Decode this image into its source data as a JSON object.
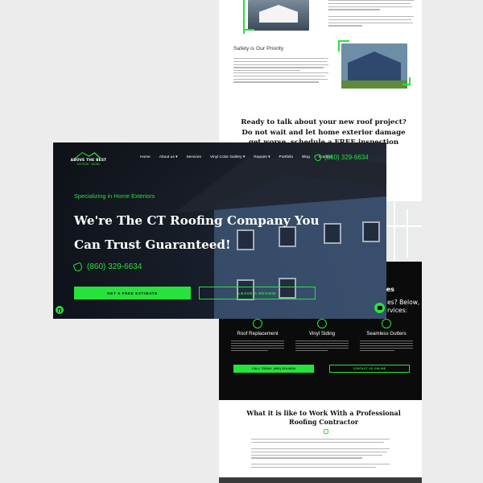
{
  "background_page": {
    "safety_title": "Safety is Our Priority",
    "cta_heading": "Ready to talk about your new roof project? Do not wait and let home exterior damage get worse, schedule a FREE inspection today.",
    "services_partial_title": "ces",
    "services_partial_sub": "es? Below, we\nrvices:",
    "services": [
      {
        "label": "Roof Replacement",
        "icon": "roof-icon"
      },
      {
        "label": "Vinyl Siding",
        "icon": "siding-icon"
      },
      {
        "label": "Seamless Gutters",
        "icon": "gutter-icon"
      }
    ],
    "call_button": "CALL TODAY: (860) 329-6634",
    "contact_button": "CONTACT US ONLINE",
    "work_title": "What it is like to Work With a Professional Roofing Contractor"
  },
  "hero": {
    "logo_text": "ABOVE THE BEST",
    "logo_sub": "ROOFING · SIDING",
    "nav": [
      "Home",
      "About us ▾",
      "Services",
      "Vinyl Color Gallery ▾",
      "Repairs ▾",
      "Portfolio",
      "Blog",
      "Contact"
    ],
    "nav_phone": "(860) 329-6634",
    "eyebrow": "Specializing in Home Exteriors",
    "headline": "We're The CT Roofing Company You Can Trust Guaranteed!",
    "phone": "(860) 329-6634",
    "primary_button": "GET A FREE ESTIMATE",
    "secondary_button": "LEAVE A REVIEW"
  },
  "colors": {
    "accent": "#25e33b",
    "dark": "#0b0b0b",
    "hero_overlay": "#0c0e14"
  }
}
